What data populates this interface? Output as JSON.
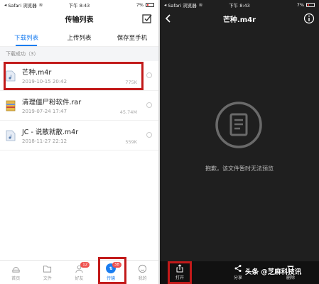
{
  "left": {
    "status": {
      "carrier": "Safari 浏览器",
      "time": "下午 8:43",
      "battery": "7%"
    },
    "nav_title": "传输列表",
    "tabs": [
      {
        "label": "下载列表",
        "active": true
      },
      {
        "label": "上传列表",
        "active": false
      },
      {
        "label": "保存至手机",
        "active": false
      }
    ],
    "section_label": "下载成功（3）",
    "files": [
      {
        "name": "芒种.m4r",
        "date": "2019-10-15 20:42",
        "size": "775K",
        "icon": "music-file-icon"
      },
      {
        "name": "清理僵尸粉软件.rar",
        "date": "2019-07-24 17:47",
        "size": "45.74M",
        "icon": "archive-file-icon"
      },
      {
        "name": "JC - 说散就散.m4r",
        "date": "2018-11-27 22:12",
        "size": "559K",
        "icon": "music-file-icon"
      }
    ],
    "tabbar": [
      {
        "label": "首页",
        "icon": "home-icon",
        "badge": ""
      },
      {
        "label": "文件",
        "icon": "folder-icon",
        "badge": ""
      },
      {
        "label": "好友",
        "icon": "friends-icon",
        "badge": "12"
      },
      {
        "label": "传输",
        "icon": "transfer-icon",
        "badge": "38",
        "active": true
      },
      {
        "label": "我的",
        "icon": "profile-icon",
        "badge": ""
      }
    ]
  },
  "right": {
    "status": {
      "carrier": "Safari 浏览器",
      "time": "下午 8:43",
      "battery": "7%"
    },
    "nav_title": "芒种.m4r",
    "preview_message": "抱歉，该文件暂时无法预览",
    "toolbar": [
      {
        "label": "打开",
        "icon": "open-share-icon"
      },
      {
        "label": "分享",
        "icon": "share-icon"
      },
      {
        "label": "删除",
        "icon": "delete-icon"
      }
    ],
    "watermark": "头条 @芝麻科技讯"
  },
  "colors": {
    "accent": "#1a7df0",
    "highlight": "#c21a1a",
    "dark_bg": "#1f1f1f"
  }
}
